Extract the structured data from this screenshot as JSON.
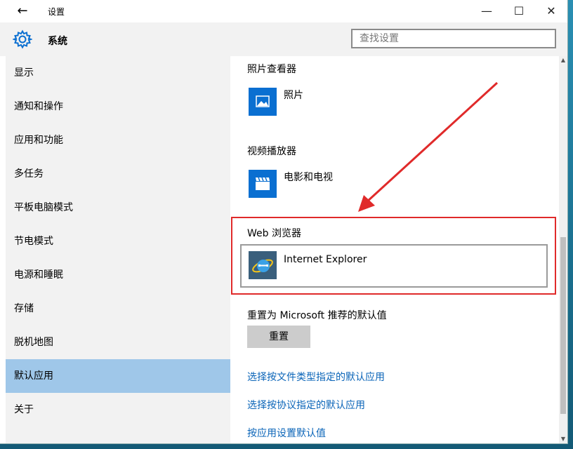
{
  "titlebar": {
    "title": "设置",
    "back": "←",
    "minimize": "—",
    "maximize": "☐",
    "close": "✕"
  },
  "header": {
    "title": "系统",
    "search_placeholder": "查找设置"
  },
  "sidebar": {
    "items": [
      {
        "label": "显示",
        "active": false
      },
      {
        "label": "通知和操作",
        "active": false
      },
      {
        "label": "应用和功能",
        "active": false
      },
      {
        "label": "多任务",
        "active": false
      },
      {
        "label": "平板电脑模式",
        "active": false
      },
      {
        "label": "节电模式",
        "active": false
      },
      {
        "label": "电源和睡眠",
        "active": false
      },
      {
        "label": "存储",
        "active": false
      },
      {
        "label": "脱机地图",
        "active": false
      },
      {
        "label": "默认应用",
        "active": true
      },
      {
        "label": "关于",
        "active": false
      }
    ]
  },
  "content": {
    "photo_viewer": {
      "label": "照片查看器",
      "app": "照片"
    },
    "video_player": {
      "label": "视频播放器",
      "app": "电影和电视"
    },
    "web_browser": {
      "label": "Web 浏览器",
      "app": "Internet Explorer"
    },
    "reset_label": "重置为 Microsoft 推荐的默认值",
    "reset_button": "重置",
    "links": [
      "选择按文件类型指定的默认应用",
      "选择按协议指定的默认应用",
      "按应用设置默认值"
    ]
  },
  "colors": {
    "accent": "#0a6fd1",
    "sidebar_active": "#9fc7e9",
    "link": "#0a64b8",
    "annotation_red": "#e02a2a"
  }
}
